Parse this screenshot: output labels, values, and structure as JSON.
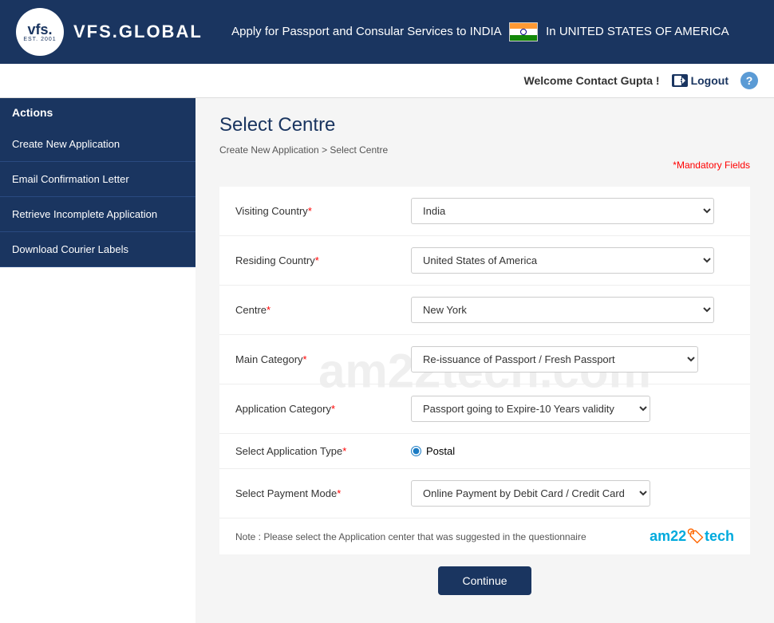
{
  "header": {
    "logo_vfs": "vfs.",
    "logo_est": "EST. 2001",
    "logo_brand": "VFS.GLOBAL",
    "tagline": "Apply for Passport and Consular Services to INDIA",
    "country": "In UNITED STATES OF AMERICA"
  },
  "userbar": {
    "welcome": "Welcome Contact Gupta !",
    "logout": "Logout",
    "help": "?"
  },
  "sidebar": {
    "header": "Actions",
    "items": [
      {
        "label": "Create New Application"
      },
      {
        "label": "Email Confirmation Letter"
      },
      {
        "label": "Retrieve Incomplete Application"
      },
      {
        "label": "Download Courier Labels"
      }
    ]
  },
  "content": {
    "page_title": "Select Centre",
    "breadcrumb_home": "Create New Application",
    "breadcrumb_sep": " > ",
    "breadcrumb_current": "Select Centre",
    "mandatory_note": "Mandatory Fields",
    "watermark": "am22tech.com",
    "form": {
      "visiting_country_label": "Visiting Country",
      "visiting_country_value": "India",
      "visiting_country_options": [
        "India"
      ],
      "residing_country_label": "Residing Country",
      "residing_country_value": "United States of America",
      "residing_country_options": [
        "United States of America"
      ],
      "centre_label": "Centre",
      "centre_value": "New York",
      "centre_options": [
        "New York"
      ],
      "main_category_label": "Main Category",
      "main_category_value": "Re-issuance of Passport / Fresh Passport",
      "main_category_options": [
        "Re-issuance of Passport / Fresh Passport"
      ],
      "app_category_label": "Application Category",
      "app_category_value": "Passport going to Expire-10 Years validity",
      "app_category_options": [
        "Passport going to Expire-10 Years validity"
      ],
      "app_type_label": "Select Application Type",
      "app_type_value": "Postal",
      "payment_mode_label": "Select Payment Mode",
      "payment_mode_value": "Online Payment by Debit Card / Credit Card",
      "payment_mode_options": [
        "Online Payment by Debit Card / Credit Card"
      ],
      "note": "Note : Please select the Application center that was suggested in the questionnaire",
      "continue_btn": "Continue"
    }
  }
}
